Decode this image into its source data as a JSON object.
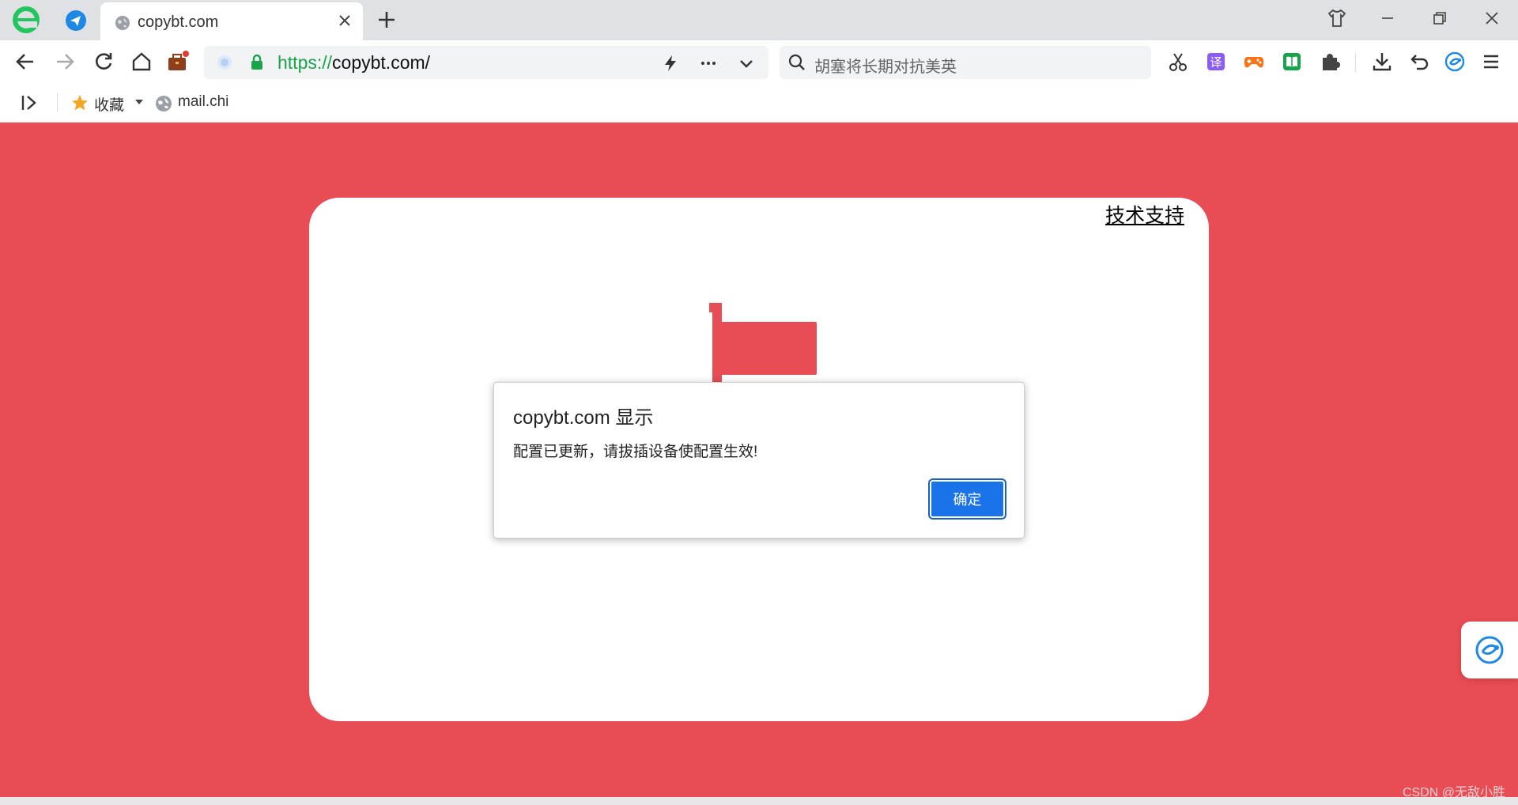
{
  "browser": {
    "tab": {
      "title": "copybt.com"
    },
    "address": {
      "scheme": "https://",
      "host": "copybt.com/"
    },
    "search": {
      "placeholder": "胡塞将长期对抗美英"
    },
    "bookmarks": {
      "favorites_label": "收藏",
      "item_label": "mail.chi"
    }
  },
  "page": {
    "support_link": "技术支持"
  },
  "alert": {
    "title": "copybt.com 显示",
    "message": "配置已更新，请拔插设备使配置生效!",
    "ok_label": "确定"
  },
  "watermark": "CSDN @无敌小胜",
  "colors": {
    "page_background": "#e84c54",
    "accent": "#1a73e8",
    "cart": "#e84c54"
  }
}
